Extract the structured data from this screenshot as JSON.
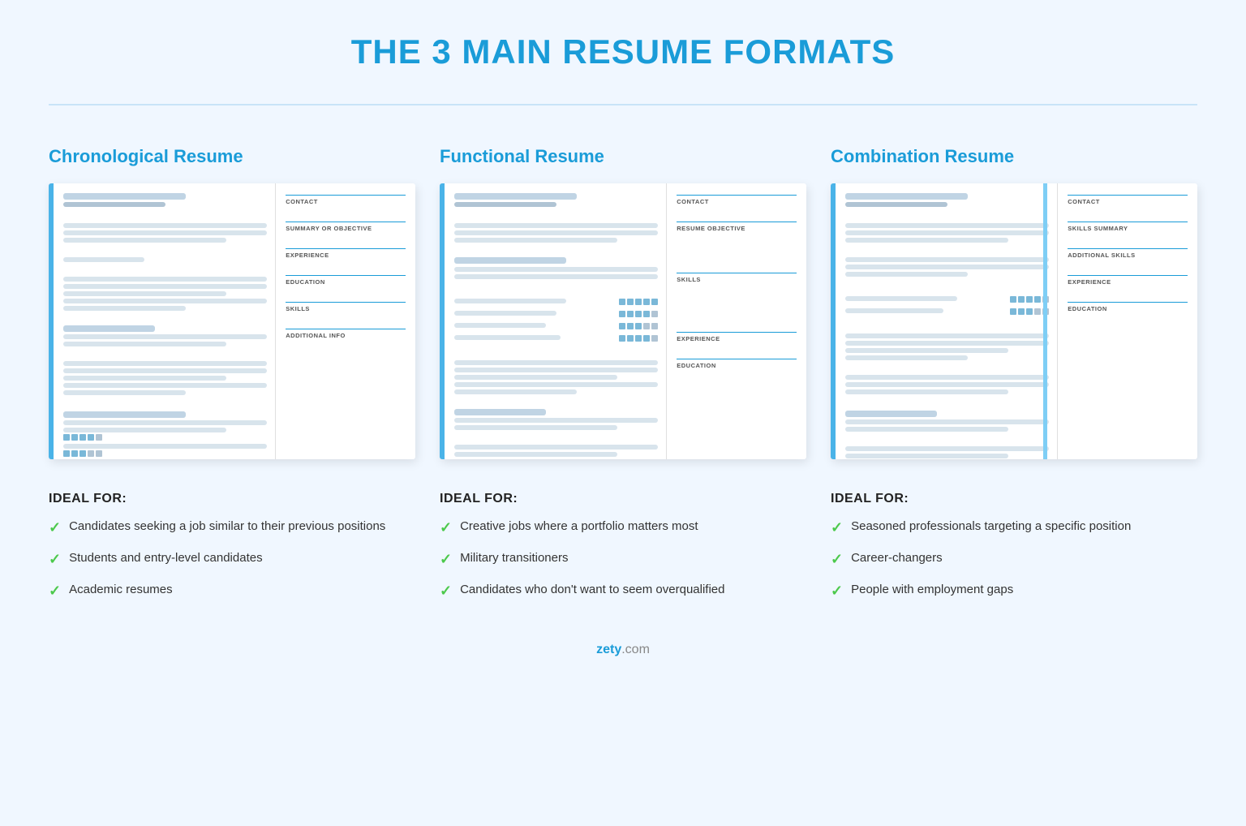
{
  "page": {
    "title": "THE 3 MAIN RESUME FORMATS",
    "footer": "zety.com"
  },
  "columns": [
    {
      "id": "chronological",
      "title": "Chronological Resume",
      "resume_labels": [
        "CONTACT",
        "SUMMARY OR OBJECTIVE",
        "EXPERIENCE",
        "EDUCATION",
        "SKILLS",
        "ADDITIONAL INFO"
      ],
      "ideal_title": "IDEAL FOR:",
      "ideal_items": [
        "Candidates seeking a job similar to their previous positions",
        "Students and entry-level candidates",
        "Academic resumes"
      ]
    },
    {
      "id": "functional",
      "title": "Functional Resume",
      "resume_labels": [
        "CONTACT",
        "RESUME OBJECTIVE",
        "SKILLS",
        "EXPERIENCE",
        "EDUCATION"
      ],
      "ideal_title": "IDEAL FOR:",
      "ideal_items": [
        "Creative jobs where a portfolio matters most",
        "Military transitioners",
        "Candidates who don't want to seem overqualified"
      ]
    },
    {
      "id": "combination",
      "title": "Combination Resume",
      "resume_labels": [
        "CONTACT",
        "SKILLS SUMMARY",
        "ADDITIONAL SKILLS",
        "EXPERIENCE",
        "EDUCATION"
      ],
      "ideal_title": "IDEAL FOR:",
      "ideal_items": [
        "Seasoned professionals targeting a specific position",
        "Career-changers",
        "People with employment gaps"
      ]
    }
  ],
  "checkmark": "✓"
}
